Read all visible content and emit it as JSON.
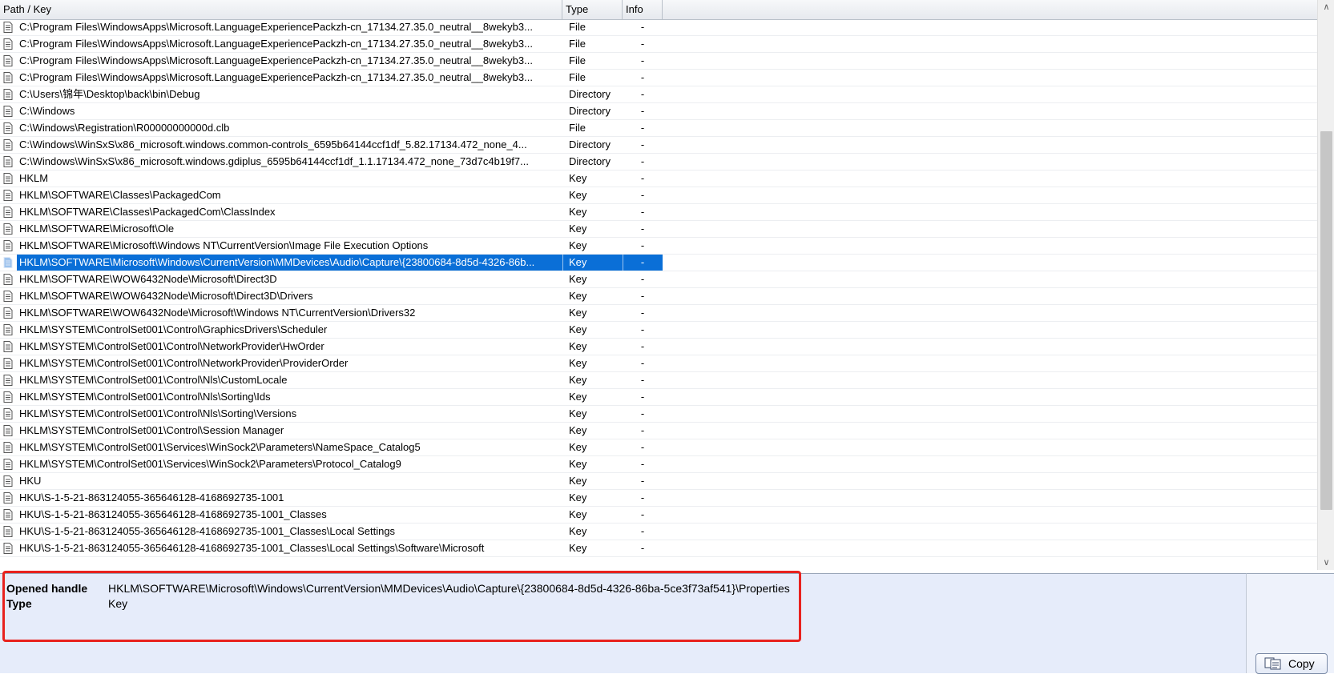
{
  "columns": {
    "path": "Path / Key",
    "type": "Type",
    "info": "Info"
  },
  "rows": [
    {
      "path": "C:\\Program Files\\WindowsApps\\Microsoft.LanguageExperiencePackzh-cn_17134.27.35.0_neutral__8wekyb3...",
      "type": "File",
      "info": "-"
    },
    {
      "path": "C:\\Program Files\\WindowsApps\\Microsoft.LanguageExperiencePackzh-cn_17134.27.35.0_neutral__8wekyb3...",
      "type": "File",
      "info": "-"
    },
    {
      "path": "C:\\Program Files\\WindowsApps\\Microsoft.LanguageExperiencePackzh-cn_17134.27.35.0_neutral__8wekyb3...",
      "type": "File",
      "info": "-"
    },
    {
      "path": "C:\\Program Files\\WindowsApps\\Microsoft.LanguageExperiencePackzh-cn_17134.27.35.0_neutral__8wekyb3...",
      "type": "File",
      "info": "-"
    },
    {
      "path": "C:\\Users\\锦年\\Desktop\\back\\bin\\Debug",
      "type": "Directory",
      "info": "-"
    },
    {
      "path": "C:\\Windows",
      "type": "Directory",
      "info": "-"
    },
    {
      "path": "C:\\Windows\\Registration\\R00000000000d.clb",
      "type": "File",
      "info": "-"
    },
    {
      "path": "C:\\Windows\\WinSxS\\x86_microsoft.windows.common-controls_6595b64144ccf1df_5.82.17134.472_none_4...",
      "type": "Directory",
      "info": "-"
    },
    {
      "path": "C:\\Windows\\WinSxS\\x86_microsoft.windows.gdiplus_6595b64144ccf1df_1.1.17134.472_none_73d7c4b19f7...",
      "type": "Directory",
      "info": "-"
    },
    {
      "path": "HKLM",
      "type": "Key",
      "info": "-"
    },
    {
      "path": "HKLM\\SOFTWARE\\Classes\\PackagedCom",
      "type": "Key",
      "info": "-"
    },
    {
      "path": "HKLM\\SOFTWARE\\Classes\\PackagedCom\\ClassIndex",
      "type": "Key",
      "info": "-"
    },
    {
      "path": "HKLM\\SOFTWARE\\Microsoft\\Ole",
      "type": "Key",
      "info": "-"
    },
    {
      "path": "HKLM\\SOFTWARE\\Microsoft\\Windows NT\\CurrentVersion\\Image File Execution Options",
      "type": "Key",
      "info": "-"
    },
    {
      "path": "HKLM\\SOFTWARE\\Microsoft\\Windows\\CurrentVersion\\MMDevices\\Audio\\Capture\\{23800684-8d5d-4326-86b...",
      "type": "Key",
      "info": "-",
      "selected": true
    },
    {
      "path": "HKLM\\SOFTWARE\\WOW6432Node\\Microsoft\\Direct3D",
      "type": "Key",
      "info": "-"
    },
    {
      "path": "HKLM\\SOFTWARE\\WOW6432Node\\Microsoft\\Direct3D\\Drivers",
      "type": "Key",
      "info": "-"
    },
    {
      "path": "HKLM\\SOFTWARE\\WOW6432Node\\Microsoft\\Windows NT\\CurrentVersion\\Drivers32",
      "type": "Key",
      "info": "-"
    },
    {
      "path": "HKLM\\SYSTEM\\ControlSet001\\Control\\GraphicsDrivers\\Scheduler",
      "type": "Key",
      "info": "-"
    },
    {
      "path": "HKLM\\SYSTEM\\ControlSet001\\Control\\NetworkProvider\\HwOrder",
      "type": "Key",
      "info": "-"
    },
    {
      "path": "HKLM\\SYSTEM\\ControlSet001\\Control\\NetworkProvider\\ProviderOrder",
      "type": "Key",
      "info": "-"
    },
    {
      "path": "HKLM\\SYSTEM\\ControlSet001\\Control\\Nls\\CustomLocale",
      "type": "Key",
      "info": "-"
    },
    {
      "path": "HKLM\\SYSTEM\\ControlSet001\\Control\\Nls\\Sorting\\Ids",
      "type": "Key",
      "info": "-"
    },
    {
      "path": "HKLM\\SYSTEM\\ControlSet001\\Control\\Nls\\Sorting\\Versions",
      "type": "Key",
      "info": "-"
    },
    {
      "path": "HKLM\\SYSTEM\\ControlSet001\\Control\\Session Manager",
      "type": "Key",
      "info": "-"
    },
    {
      "path": "HKLM\\SYSTEM\\ControlSet001\\Services\\WinSock2\\Parameters\\NameSpace_Catalog5",
      "type": "Key",
      "info": "-"
    },
    {
      "path": "HKLM\\SYSTEM\\ControlSet001\\Services\\WinSock2\\Parameters\\Protocol_Catalog9",
      "type": "Key",
      "info": "-"
    },
    {
      "path": "HKU",
      "type": "Key",
      "info": "-"
    },
    {
      "path": "HKU\\S-1-5-21-863124055-365646128-4168692735-1001",
      "type": "Key",
      "info": "-"
    },
    {
      "path": "HKU\\S-1-5-21-863124055-365646128-4168692735-1001_Classes",
      "type": "Key",
      "info": "-"
    },
    {
      "path": "HKU\\S-1-5-21-863124055-365646128-4168692735-1001_Classes\\Local Settings",
      "type": "Key",
      "info": "-"
    },
    {
      "path": "HKU\\S-1-5-21-863124055-365646128-4168692735-1001_Classes\\Local Settings\\Software\\Microsoft",
      "type": "Key",
      "info": "-"
    }
  ],
  "details": {
    "handle_label": "Opened handle",
    "handle_value": "HKLM\\SOFTWARE\\Microsoft\\Windows\\CurrentVersion\\MMDevices\\Audio\\Capture\\{23800684-8d5d-4326-86ba-5ce3f73af541}\\Properties",
    "type_label": "Type",
    "type_value": "Key"
  },
  "copy_button": {
    "label": "Copy",
    "icon": "copy-icon"
  },
  "row_icon": "file-icon",
  "colors": {
    "selection": "#0a6fd7",
    "details_bg": "#e6ecfa",
    "highlight": "#e8221e"
  },
  "scrollbar": {
    "position_fraction": 0.72,
    "visible_fraction": 0.7
  }
}
